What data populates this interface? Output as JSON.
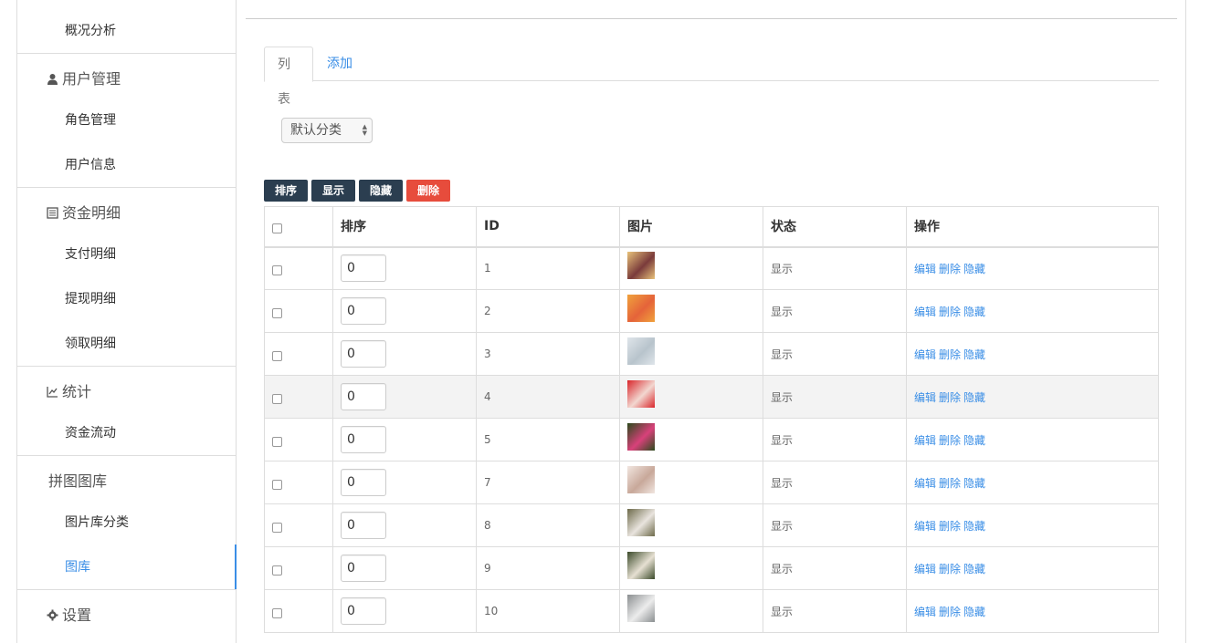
{
  "sidebar": {
    "items": [
      {
        "label": "概况分析",
        "type": "item"
      },
      {
        "label": "用户管理",
        "type": "group",
        "icon": "user-icon"
      },
      {
        "label": "角色管理",
        "type": "item"
      },
      {
        "label": "用户信息",
        "type": "item"
      },
      {
        "label": "资金明细",
        "type": "group",
        "icon": "list-icon"
      },
      {
        "label": "支付明细",
        "type": "item"
      },
      {
        "label": "提现明细",
        "type": "item"
      },
      {
        "label": "领取明细",
        "type": "item"
      },
      {
        "label": "统计",
        "type": "group",
        "icon": "chart-icon"
      },
      {
        "label": "资金流动",
        "type": "item"
      },
      {
        "label": "拼图图库",
        "type": "group",
        "icon": ""
      },
      {
        "label": "图片库分类",
        "type": "item"
      },
      {
        "label": "图库",
        "type": "item",
        "active": true
      },
      {
        "label": "设置",
        "type": "group",
        "icon": "gear-icon"
      }
    ]
  },
  "tabs": {
    "list": "列表",
    "add": "添加"
  },
  "filter": {
    "category": "默认分类"
  },
  "actions": {
    "sort": "排序",
    "show": "显示",
    "hide": "隐藏",
    "delete": "删除"
  },
  "table": {
    "headers": {
      "sort": "排序",
      "id": "ID",
      "image": "图片",
      "status": "状态",
      "ops": "操作"
    },
    "op_labels": {
      "edit": "编辑",
      "delete": "删除",
      "hide": "隐藏"
    },
    "rows": [
      {
        "sort": "0",
        "id": "1",
        "status": "显示",
        "thumb_colors": [
          "#e8c27a",
          "#7a3b3b"
        ]
      },
      {
        "sort": "0",
        "id": "2",
        "status": "显示",
        "thumb_colors": [
          "#f0a23c",
          "#e5633a"
        ]
      },
      {
        "sort": "0",
        "id": "3",
        "status": "显示",
        "thumb_colors": [
          "#dfe5ea",
          "#b8c4cc"
        ]
      },
      {
        "sort": "0",
        "id": "4",
        "status": "显示",
        "thumb_colors": [
          "#d9262b",
          "#f2d7d0"
        ]
      },
      {
        "sort": "0",
        "id": "5",
        "status": "显示",
        "thumb_colors": [
          "#2b4a1c",
          "#d8417a"
        ]
      },
      {
        "sort": "0",
        "id": "7",
        "status": "显示",
        "thumb_colors": [
          "#f1e6e0",
          "#c8a89a"
        ]
      },
      {
        "sort": "0",
        "id": "8",
        "status": "显示",
        "thumb_colors": [
          "#6d6a4a",
          "#e9e4de"
        ]
      },
      {
        "sort": "0",
        "id": "9",
        "status": "显示",
        "thumb_colors": [
          "#3b4a2a",
          "#e6e0d2"
        ]
      },
      {
        "sort": "0",
        "id": "10",
        "status": "显示",
        "thumb_colors": [
          "#8a8e90",
          "#ececec"
        ]
      }
    ]
  },
  "colors": {
    "accent": "#3a8ee6",
    "dark_button": "#2b3e50",
    "danger_button": "#e74c3c"
  }
}
